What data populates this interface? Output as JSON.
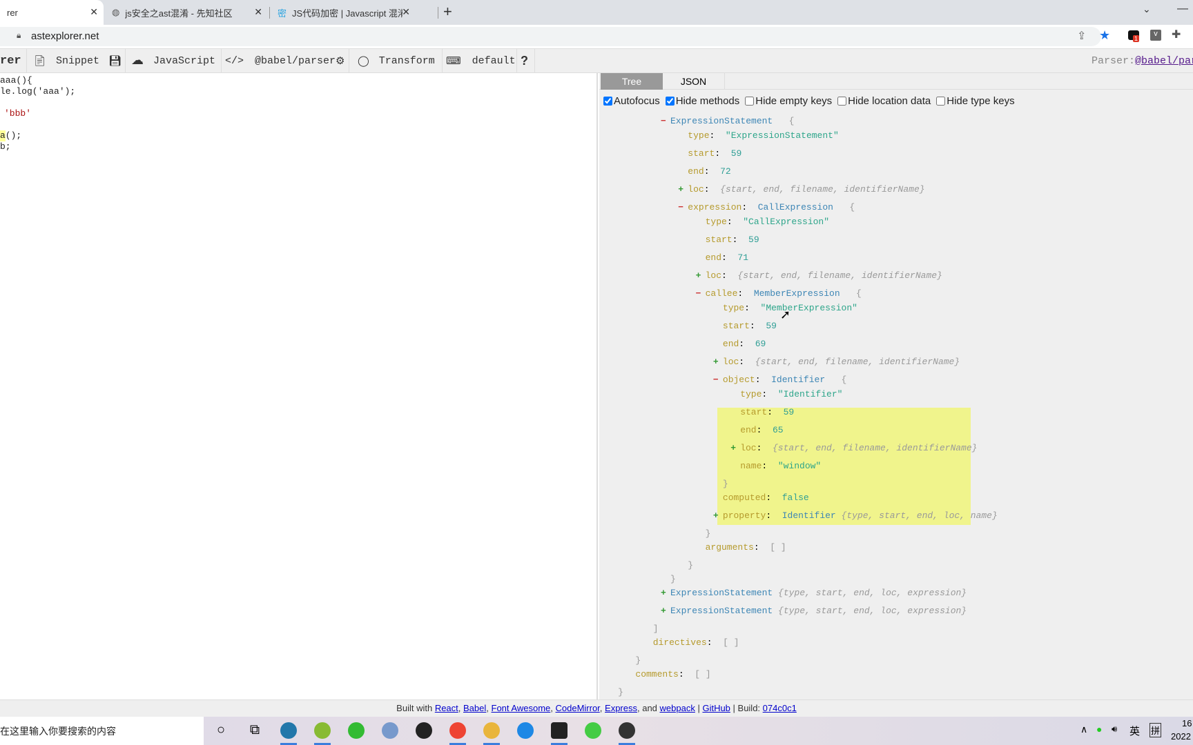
{
  "browser": {
    "tabs": [
      {
        "title": "rer",
        "active": true
      },
      {
        "title": "js安全之ast混淆 - 先知社区",
        "icon": "globe-icon"
      },
      {
        "title": "JS代码加密 | Javascript 混淆 | JS",
        "icon": "lock-mi-icon"
      }
    ],
    "new_tab": "+",
    "url": "astexplorer.net",
    "extension_badge": "1",
    "ext_v": "v"
  },
  "toolbar": {
    "brand": "rer",
    "snippet": "Snippet",
    "language": "JavaScript",
    "parser": "@babel/parser",
    "transform": "Transform",
    "keymap": "default",
    "help": "?",
    "parser_label": "Parser: ",
    "parser_link": "@babel/pars"
  },
  "editor": {
    "lines": [
      "aaa(){",
      "le.log('aaa');",
      "",
      "'bbb'",
      "",
      "a();",
      "b;"
    ]
  },
  "panel": {
    "tabs": [
      "Tree",
      "JSON"
    ],
    "options": [
      {
        "label": "Autofocus",
        "checked": true
      },
      {
        "label": "Hide methods",
        "checked": true
      },
      {
        "label": "Hide empty keys",
        "checked": false
      },
      {
        "label": "Hide location data",
        "checked": false
      },
      {
        "label": "Hide type keys",
        "checked": false
      }
    ]
  },
  "tree": [
    {
      "lv": 0,
      "t": "m",
      "h": "o",
      "type": "ExpressionStatement",
      "br": "{"
    },
    {
      "lv": 1,
      "key": "type",
      "str": "\"ExpressionStatement\""
    },
    {
      "lv": 1,
      "key": "start",
      "num": "59"
    },
    {
      "lv": 1,
      "key": "end",
      "num": "72"
    },
    {
      "lv": 1,
      "t": "p",
      "key": "loc",
      "sum": "{start, end, filename, identifierName}"
    },
    {
      "lv": 1,
      "t": "m",
      "h": "o",
      "key": "expression",
      "type": "CallExpression",
      "br": "{"
    },
    {
      "lv": 2,
      "key": "type",
      "str": "\"CallExpression\""
    },
    {
      "lv": 2,
      "key": "start",
      "num": "59"
    },
    {
      "lv": 2,
      "key": "end",
      "num": "71"
    },
    {
      "lv": 2,
      "t": "p",
      "key": "loc",
      "sum": "{start, end, filename, identifierName}"
    },
    {
      "lv": 2,
      "t": "m",
      "h": "o",
      "key": "callee",
      "type": "MemberExpression",
      "br": "{"
    },
    {
      "lv": 3,
      "key": "type",
      "str": "\"MemberExpression\""
    },
    {
      "lv": 3,
      "key": "start",
      "num": "59"
    },
    {
      "lv": 3,
      "key": "end",
      "num": "69"
    },
    {
      "lv": 3,
      "t": "p",
      "key": "loc",
      "sum": "{start, end, filename, identifierName}"
    },
    {
      "lv": 3,
      "t": "m",
      "h": "o",
      "key": "object",
      "type": "Identifier",
      "br": "{"
    },
    {
      "lv": 4,
      "key": "type",
      "str": "\"Identifier\""
    },
    {
      "lv": 4,
      "key": "start",
      "num": "59"
    },
    {
      "lv": 4,
      "key": "end",
      "num": "65"
    },
    {
      "lv": 4,
      "t": "p",
      "key": "loc",
      "sum": "{start, end, filename, identifierName}"
    },
    {
      "lv": 4,
      "key": "name",
      "str": "\"window\""
    },
    {
      "lv": 3,
      "h": "c",
      "close": "}"
    },
    {
      "lv": 3,
      "key": "computed",
      "num": "false"
    },
    {
      "lv": 3,
      "t": "p",
      "key": "property",
      "type": "Identifier",
      "sum": "{type, start, end, loc, name}"
    },
    {
      "lv": 2,
      "h": "c",
      "close": "}"
    },
    {
      "lv": 2,
      "key": "arguments",
      "brk": "[ ]"
    },
    {
      "lv": 1,
      "h": "c",
      "close": "}"
    },
    {
      "lv": 0,
      "h": "c",
      "close": "}"
    },
    {
      "lv": 0,
      "t": "p",
      "type": "ExpressionStatement",
      "sum": "{type, start, end, loc, expression}"
    },
    {
      "lv": 0,
      "t": "p",
      "type": "ExpressionStatement",
      "sum": "{type, start, end, loc, expression}"
    },
    {
      "lv": -1,
      "h": "c",
      "close": "]"
    },
    {
      "lv": -1,
      "key": "directives",
      "brk": "[ ]"
    },
    {
      "lv": -2,
      "h": "c",
      "close": "}"
    },
    {
      "lv": -2,
      "key": "comments",
      "brk": "[ ]"
    },
    {
      "lv": -3,
      "h": "c",
      "close": "}"
    }
  ],
  "highlight_node": "object: Identifier",
  "footer": {
    "prefix": "Built with ",
    "links": [
      "React",
      "Babel",
      "Font Awesome",
      "CodeMirror",
      "Express"
    ],
    "and": ", and ",
    "webpack": "webpack",
    "github": "GitHub",
    "build_label": " | Build: ",
    "build": "074c0c1"
  },
  "taskbar": {
    "search_placeholder": "在这里输入你要搜索的内容",
    "apps": [
      "cortana-icon",
      "task-view-icon",
      "pycharm-icon",
      "notepad-icon",
      "app-green-icon",
      "app-baidu-icon",
      "qq-icon",
      "chrome-icon",
      "file-explorer-icon",
      "app-blue-icon",
      "terminal-icon",
      "wechat-icon",
      "obs-icon"
    ],
    "ime1": "英",
    "ime2": "拼",
    "time": "16",
    "date": "2022"
  },
  "colors": {
    "key": "#b59a2c",
    "type_name": "#3d86b5",
    "string": "#2da58a",
    "highlight": "#f0f48c",
    "collapse": "#cc3333",
    "expand": "#339933"
  }
}
